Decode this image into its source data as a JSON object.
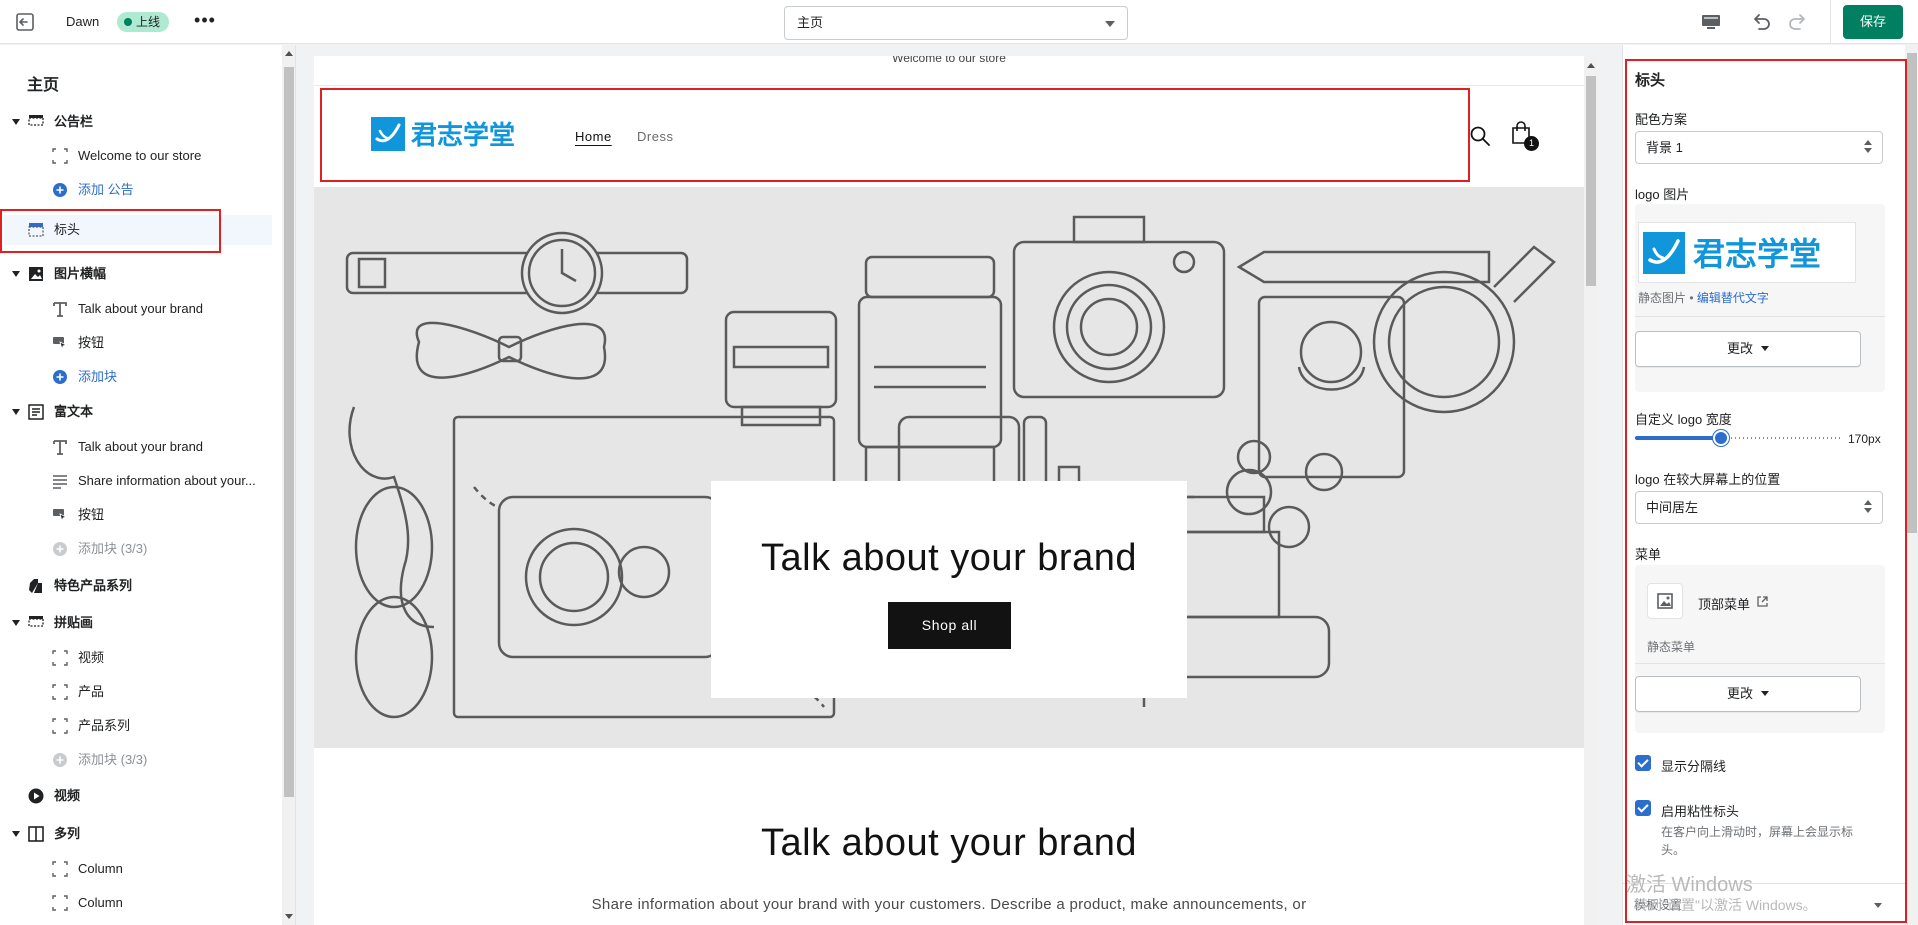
{
  "topbar": {
    "theme_name": "Dawn",
    "status_badge": "上线",
    "page_select": "主页",
    "save_label": "保存",
    "icons": [
      "exit-icon",
      "more-icon",
      "desktop-preview-icon",
      "undo-icon",
      "redo-icon"
    ]
  },
  "colors": {
    "accent_green": "#008060",
    "badge_green": "#aee9d1",
    "link_blue": "#2c6ecb",
    "annotation_red": "#e02020",
    "logo_blue": "#1296db"
  },
  "sidebar": {
    "title": "主页",
    "items": [
      {
        "label": "公告栏"
      },
      {
        "label": "Welcome to our store"
      },
      {
        "label": "添加 公告"
      },
      {
        "label": "标头"
      },
      {
        "label": "图片横幅"
      },
      {
        "label": "Talk about your brand"
      },
      {
        "label": "按钮"
      },
      {
        "label": "添加块"
      },
      {
        "label": "富文本"
      },
      {
        "label": "Talk about your brand"
      },
      {
        "label": "Share information about your..."
      },
      {
        "label": "按钮"
      },
      {
        "label": "添加块 (3/3)"
      },
      {
        "label": "特色产品系列"
      },
      {
        "label": "拼贴画"
      },
      {
        "label": "视频"
      },
      {
        "label": "产品"
      },
      {
        "label": "产品系列"
      },
      {
        "label": "添加块 (3/3)"
      },
      {
        "label": "视频"
      },
      {
        "label": "多列"
      },
      {
        "label": "Column"
      },
      {
        "label": "Column"
      }
    ]
  },
  "preview": {
    "announcement": "Welcome to our store",
    "logo_text": "君志学堂",
    "nav": [
      "Home",
      "Dress"
    ],
    "cart_count": "1",
    "hero_title": "Talk about your brand",
    "hero_button": "Shop all",
    "richtext_title": "Talk about your brand",
    "richtext_text": "Share information about your brand with your customers. Describe a product, make announcements, or"
  },
  "panel": {
    "title": "标头",
    "color_scheme_label": "配色方案",
    "color_scheme_value": "背景 1",
    "logo_label": "logo 图片",
    "logo_text": "君志学堂",
    "logo_static": "静态图片 •",
    "logo_alt_link": "编辑替代文字",
    "change_label": "更改",
    "logo_width_label": "自定义 logo 宽度",
    "logo_width_value": "170px",
    "logo_width_fraction": 0.42,
    "logo_position_label": "logo 在较大屏幕上的位置",
    "logo_position_value": "中间居左",
    "menu_label": "菜单",
    "menu_name": "顶部菜单",
    "menu_static": "静态菜单",
    "show_divider_label": "显示分隔线",
    "sticky_label": "启用粘性标头",
    "sticky_help": "在客户向上滑动时，屏幕上会显示标头。",
    "template_settings": "模板设置"
  },
  "watermark": {
    "line1": "激活 Windows",
    "line2": "转到\"设置\"以激活 Windows。"
  }
}
